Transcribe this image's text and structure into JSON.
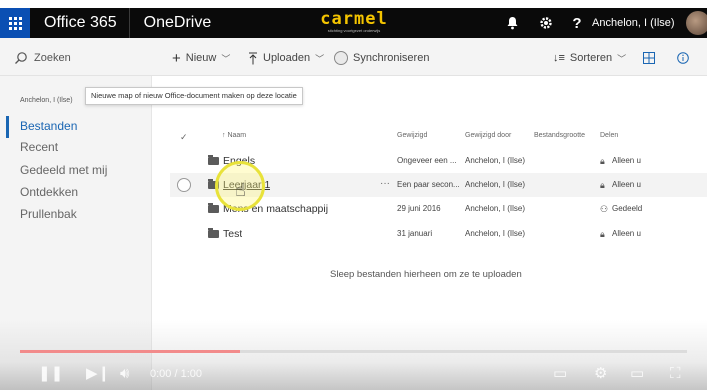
{
  "suite": {
    "brand": "Office 365",
    "app": "OneDrive",
    "logo_word": "carmel",
    "logo_tagline": "stichting voortgezet onderwijs",
    "user": "Anchelon, I (Ilse)",
    "icons": [
      "waffle-icon",
      "bell-icon",
      "gear-icon",
      "help-icon"
    ]
  },
  "command_bar": {
    "search_placeholder": "Zoeken",
    "new_label": "Nieuw",
    "upload_label": "Uploaden",
    "sync_label": "Synchroniseren",
    "sort_label": "Sorteren"
  },
  "tooltip": "Nieuwe map of nieuw Office-document maken op deze locatie",
  "nav": {
    "owner": "Anchelon, I (Ilse)",
    "items": [
      {
        "label": "Bestanden",
        "active": true
      },
      {
        "label": "Recent",
        "active": false
      },
      {
        "label": "Gedeeld met mij",
        "active": false
      },
      {
        "label": "Ontdekken",
        "active": false
      },
      {
        "label": "Prullenbak",
        "active": false
      }
    ]
  },
  "list": {
    "headers": {
      "name": "↑ Naam",
      "modified": "Gewijzigd",
      "modified_by": "Gewijzigd door",
      "size": "Bestandsgrootte",
      "sharing": "Delen"
    },
    "rows": [
      {
        "name": "Engels",
        "modified": "Ongeveer een ...",
        "modified_by": "Anchelon, I (Ilse)",
        "sharing": "Alleen u",
        "share_icon": "lock-icon",
        "selected": false
      },
      {
        "name": "Leerjaar 1",
        "modified": "Een paar secon...",
        "modified_by": "Anchelon, I (Ilse)",
        "sharing": "Alleen u",
        "share_icon": "lock-icon",
        "selected": true
      },
      {
        "name": "Mens en maatschappij",
        "modified": "29 juni 2016",
        "modified_by": "Anchelon, I (Ilse)",
        "sharing": "Gedeeld",
        "share_icon": "people-icon",
        "selected": false
      },
      {
        "name": "Test",
        "modified": "31 januari",
        "modified_by": "Anchelon, I (Ilse)",
        "sharing": "Alleen u",
        "share_icon": "lock-icon",
        "selected": false
      }
    ],
    "drop_hint": "Sleep bestanden hierheen om ze te uploaden"
  },
  "video": {
    "progress_fraction": 0.33,
    "time": "0:00 / 1:00"
  },
  "colors": {
    "suite_bar": "#0a0a0a",
    "waffle": "#0a4fb3",
    "accent": "#1a66b3",
    "logo": "#f4c400",
    "progress": "#f28b8b"
  }
}
